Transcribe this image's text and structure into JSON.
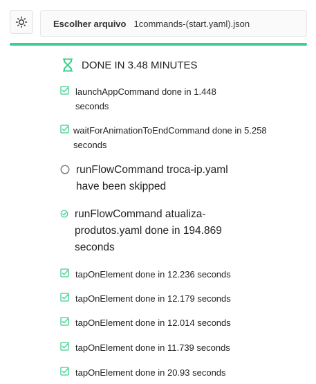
{
  "toolbar": {
    "theme_icon": "sun-icon",
    "file_button_label": "Escolher arquivo",
    "file_name": "1commands-(start.yaml).json"
  },
  "progress": {
    "percent": 100,
    "color": "#3ecf8e"
  },
  "summary": {
    "icon": "hourglass-icon",
    "text": "DONE IN 3.48 MINUTES",
    "color": "#3ecf8e"
  },
  "commands": [
    {
      "status": "done",
      "icon": "check-square-icon",
      "text": "launchAppCommand done in 1.448 seconds"
    },
    {
      "status": "done",
      "icon": "check-square-icon",
      "text": "waitForAnimationToEndCommand done in 5.258 seconds"
    },
    {
      "status": "skipped",
      "icon": "circle-icon",
      "text": "runFlowCommand troca-ip.yaml have been skipped"
    },
    {
      "status": "done",
      "icon": "check-circle-icon",
      "text": "runFlowCommand atualiza-produtos.yaml done in 194.869 seconds"
    },
    {
      "status": "done",
      "icon": "check-square-icon",
      "text": "tapOnElement done in 12.236 seconds"
    },
    {
      "status": "done",
      "icon": "check-square-icon",
      "text": "tapOnElement done in 12.179 seconds"
    },
    {
      "status": "done",
      "icon": "check-square-icon",
      "text": "tapOnElement done in 12.014 seconds"
    },
    {
      "status": "done",
      "icon": "check-square-icon",
      "text": "tapOnElement done in 11.739 seconds"
    },
    {
      "status": "done",
      "icon": "check-square-icon",
      "text": "tapOnElement done in 20.93 seconds"
    }
  ]
}
